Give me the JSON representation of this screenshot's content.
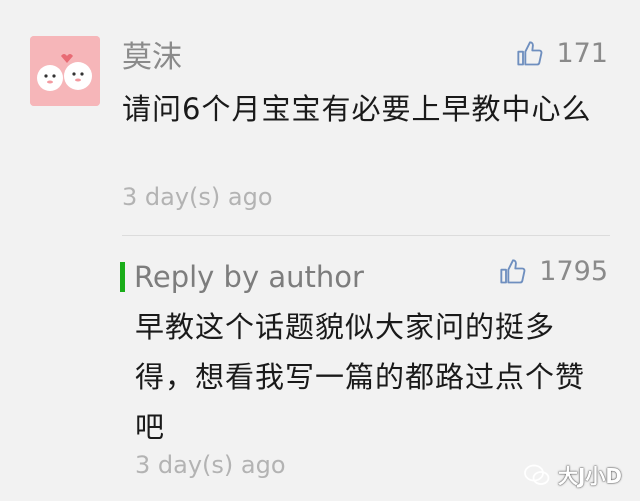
{
  "comment": {
    "username": "莫沫",
    "like_count": "171",
    "text": "请问6个月宝宝有必要上早教中心么",
    "time": "3 day(s) ago",
    "avatar_icon": "cartoon-sheep-avatar"
  },
  "reply": {
    "label": "Reply by author",
    "like_count": "1795",
    "text": "早教这个话题貌似大家问的挺多得，想看我写一篇的都路过点个赞吧",
    "time": "3 day(s) ago",
    "accent_color": "#1aad19"
  },
  "watermark": {
    "text": "大J小D",
    "icon": "wechat-icon"
  },
  "icons": {
    "like": "thumbs-up-icon"
  }
}
